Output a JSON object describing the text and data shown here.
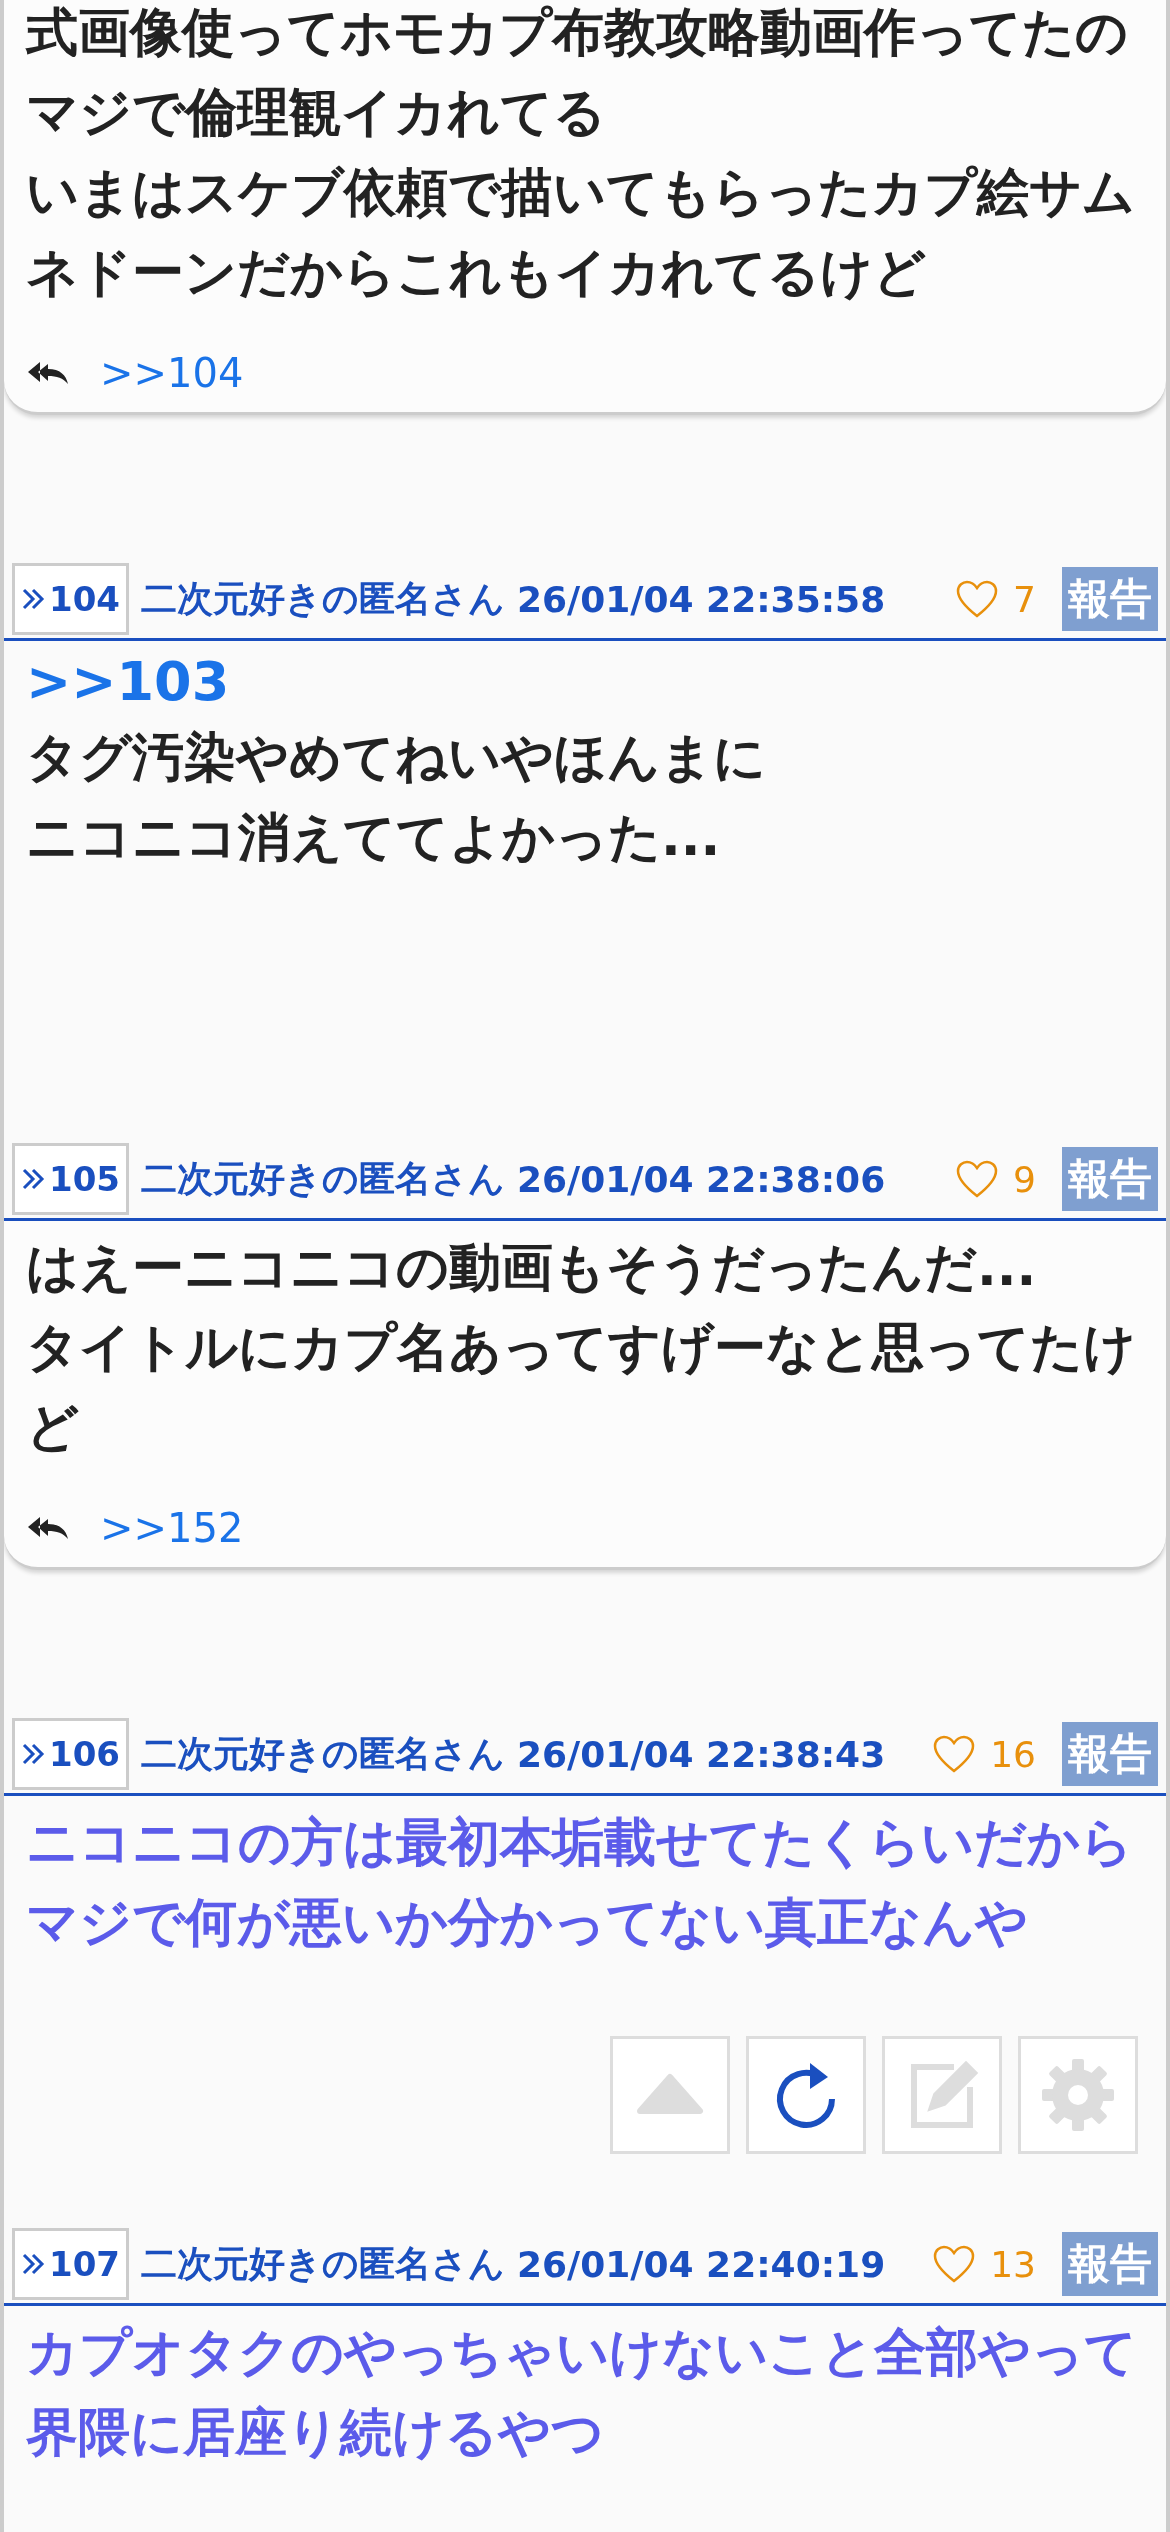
{
  "top_card": {
    "lines": [
      "式画像使ってホモカプ布教攻略動画作ってたの",
      "マジで倫理観イカれてる",
      "いまはスケブ依頼で描いてもらったカプ絵サムネドーンだからこれもイカれてるけど"
    ],
    "reply_link": ">>104"
  },
  "posts": [
    {
      "number": "104",
      "name": "二次元好きの匿名さん",
      "date": "26/01/04 22:35:58",
      "likes": "7",
      "report": "報告",
      "anchor": ">>103",
      "lines": [
        "タグ汚染やめてねいやほんまに",
        "ニコニコ消えててよかった..."
      ],
      "highlighted": false
    },
    {
      "number": "105",
      "name": "二次元好きの匿名さん",
      "date": "26/01/04 22:38:06",
      "likes": "9",
      "report": "報告",
      "lines": [
        "はえーニコニコの動画もそうだったんだ...",
        "タイトルにカプ名あってすげーなと思ってたけど"
      ],
      "highlighted": false,
      "reply_link": ">>152"
    },
    {
      "number": "106",
      "name": "二次元好きの匿名さん",
      "date": "26/01/04 22:38:43",
      "likes": "16",
      "report": "報告",
      "lines": [
        "ニコニコの方は最初本垢載せてたくらいだからマジで何が悪いか分かってない真正なんや"
      ],
      "highlighted": true
    },
    {
      "number": "107",
      "name": "二次元好きの匿名さん",
      "date": "26/01/04 22:40:19",
      "likes": "13",
      "report": "報告",
      "lines": [
        "カプオタクのやっちゃいけないこと全部やって界隈に居座り続けるやつ"
      ],
      "highlighted": true
    }
  ],
  "floating_buttons": [
    {
      "kind": "top"
    },
    {
      "kind": "reload"
    },
    {
      "kind": "write"
    },
    {
      "kind": "settings"
    }
  ]
}
